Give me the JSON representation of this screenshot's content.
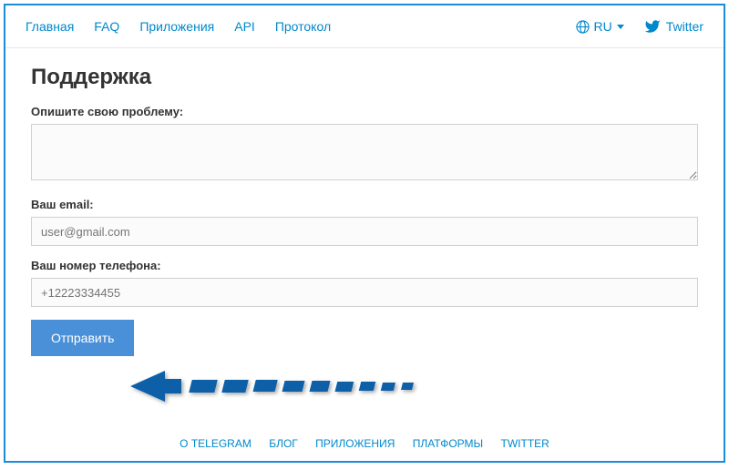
{
  "nav": {
    "links": [
      "Главная",
      "FAQ",
      "Приложения",
      "API",
      "Протокол"
    ],
    "language": "RU",
    "twitter": "Twitter"
  },
  "page": {
    "title": "Поддержка"
  },
  "form": {
    "problem_label": "Опишите свою проблему:",
    "problem_value": "",
    "email_label": "Ваш email:",
    "email_placeholder": "user@gmail.com",
    "phone_label": "Ваш номер телефона:",
    "phone_placeholder": "+12223334455",
    "submit_label": "Отправить"
  },
  "footer": {
    "links": [
      "О TELEGRAM",
      "БЛОГ",
      "ПРИЛОЖЕНИЯ",
      "ПЛАТФОРМЫ",
      "TWITTER"
    ]
  },
  "colors": {
    "link": "#0088cc",
    "border": "#1a8cd8",
    "button": "#4a90d9",
    "arrow": "#0a5ea8"
  }
}
